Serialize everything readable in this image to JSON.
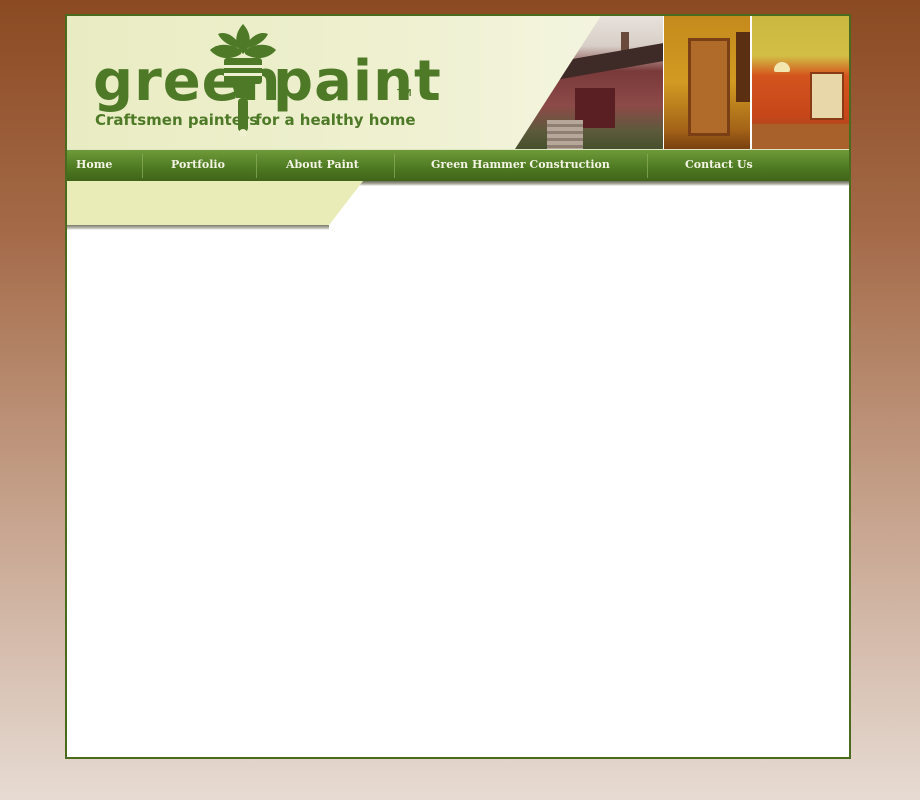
{
  "brand": {
    "word1": "green",
    "word2": "paint",
    "trademark": "TM",
    "tagline_part1": "Craftsmen painters",
    "tagline_part2": "for a healthy home",
    "color": "#4e7a28"
  },
  "banner_photos": [
    {
      "icon": "house-exterior-photo"
    },
    {
      "icon": "interior-doorway-photo"
    },
    {
      "icon": "interior-room-photo"
    }
  ],
  "nav": {
    "items": [
      {
        "label": "Home"
      },
      {
        "label": "Portfolio"
      },
      {
        "label": "About Paint"
      },
      {
        "label": "Green Hammer Construction"
      },
      {
        "label": "Contact Us"
      }
    ]
  },
  "colors": {
    "page_top": "#8b4a22",
    "page_bottom": "#e6dbd3",
    "nav_green": "#4e7a22",
    "ribbon": "#eaecb8"
  }
}
